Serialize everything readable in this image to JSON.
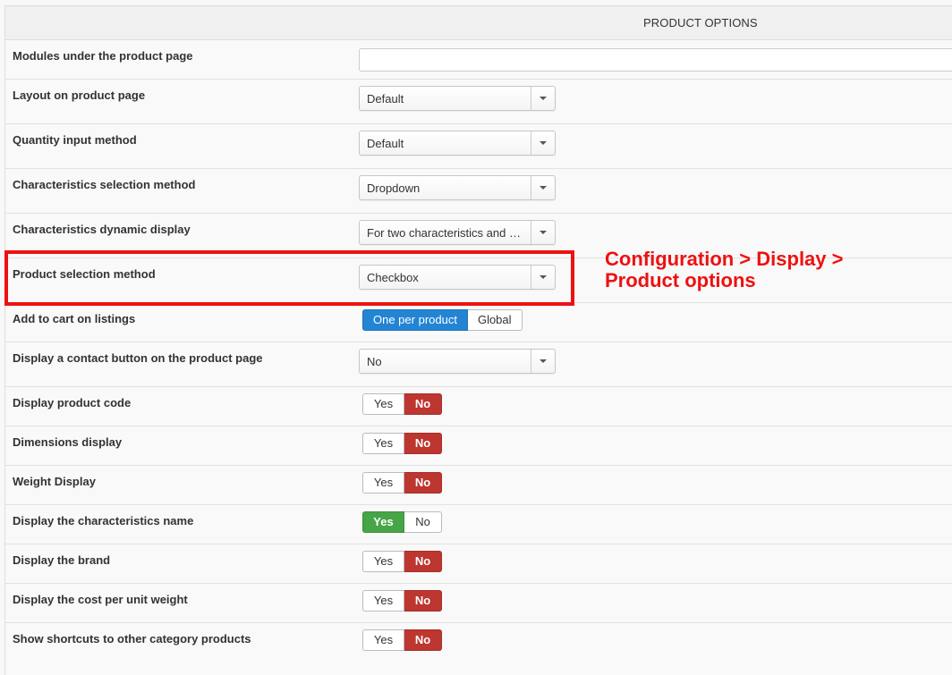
{
  "header": {
    "title": "PRODUCT OPTIONS"
  },
  "rows": {
    "modules": {
      "label": "Modules under the product page",
      "value": ""
    },
    "layout": {
      "label": "Layout on product page",
      "value": "Default"
    },
    "quantity": {
      "label": "Quantity input method",
      "value": "Default"
    },
    "char_selection": {
      "label": "Characteristics selection method",
      "value": "Dropdown"
    },
    "char_dynamic": {
      "label": "Characteristics dynamic display",
      "value": "For two characteristics and m..."
    },
    "product_selection": {
      "label": "Product selection method",
      "value": "Checkbox"
    },
    "add_to_cart": {
      "label": "Add to cart on listings",
      "option1": "One per product",
      "option2": "Global",
      "selected": "One per product"
    },
    "contact_button": {
      "label": "Display a contact button on the product page",
      "value": "No"
    },
    "product_code": {
      "label": "Display product code",
      "yes": "Yes",
      "no": "No",
      "selected": "No"
    },
    "dimensions": {
      "label": "Dimensions display",
      "yes": "Yes",
      "no": "No",
      "selected": "No"
    },
    "weight": {
      "label": "Weight Display",
      "yes": "Yes",
      "no": "No",
      "selected": "No"
    },
    "char_name": {
      "label": "Display the characteristics name",
      "yes": "Yes",
      "no": "No",
      "selected": "Yes"
    },
    "brand": {
      "label": "Display the brand",
      "yes": "Yes",
      "no": "No",
      "selected": "No"
    },
    "cost_per_unit": {
      "label": "Display the cost per unit weight",
      "yes": "Yes",
      "no": "No",
      "selected": "No"
    },
    "shortcuts": {
      "label": "Show shortcuts to other category products",
      "yes": "Yes",
      "no": "No",
      "selected": "No"
    }
  },
  "annotation": {
    "line1": "Configuration > Display >",
    "line2": "Product options",
    "color": "#ee1111"
  },
  "colors": {
    "blue": "#2384d3",
    "red": "#bd362f",
    "green": "#46a546"
  },
  "icons": {
    "select_caret": "chevron-down-icon"
  }
}
